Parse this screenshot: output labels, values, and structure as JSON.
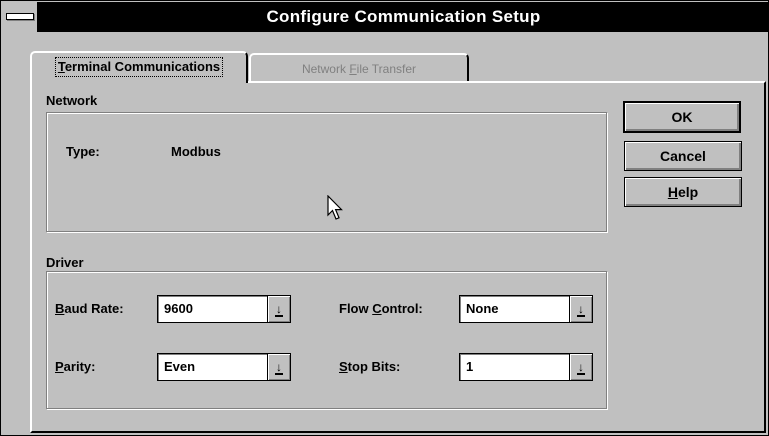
{
  "window": {
    "title": "Configure Communication Setup"
  },
  "tabs": [
    {
      "label": "Terminal Communications",
      "mnemonic": "T",
      "active": true
    },
    {
      "label": "Network File Transfer",
      "mnemonic": "F",
      "active": false
    }
  ],
  "network": {
    "heading": "Network",
    "type_label": "Type:",
    "type_value": "Modbus"
  },
  "driver": {
    "heading": "Driver",
    "baud_rate": {
      "label": "Baud Rate:",
      "mnemonic": "B",
      "value": "9600"
    },
    "parity": {
      "label": "Parity:",
      "mnemonic": "P",
      "value": "Even"
    },
    "flow_control": {
      "label": "Flow Control:",
      "mnemonic": "C",
      "value": "None"
    },
    "stop_bits": {
      "label": "Stop Bits:",
      "mnemonic": "S",
      "value": "1"
    }
  },
  "buttons": {
    "ok": "OK",
    "cancel": "Cancel",
    "help": "Help"
  },
  "icons": {
    "system_menu": "system-menu-icon",
    "dropdown": "dropdown-arrow-icon",
    "cursor": "mouse-pointer-icon"
  },
  "colors": {
    "face": "#c0c0c0",
    "title_bar": "#000000",
    "title_text": "#ffffff",
    "disabled_text": "#808080",
    "field": "#ffffff"
  }
}
